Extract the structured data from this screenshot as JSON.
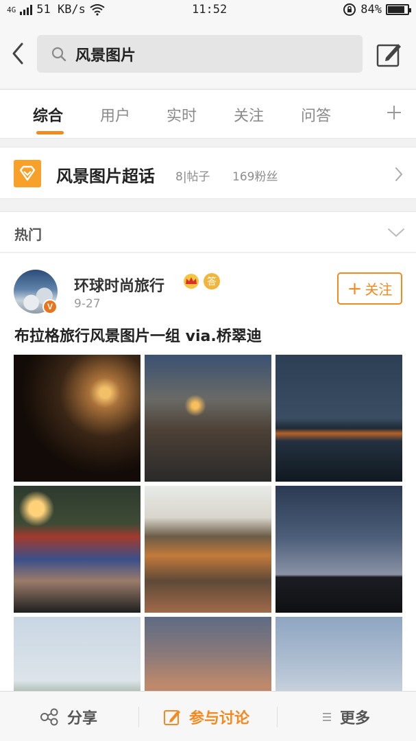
{
  "status_bar": {
    "network": "4G",
    "speed": "51 KB/s",
    "time": "11:52",
    "battery": "84%",
    "battery_level": 0.84
  },
  "header": {
    "search_query": "风景图片",
    "icons": {
      "back": "chevron-left-icon",
      "search": "search-icon",
      "edit": "edit-icon"
    }
  },
  "tabs": {
    "items": [
      {
        "label": "综合",
        "active": true
      },
      {
        "label": "用户",
        "active": false
      },
      {
        "label": "实时",
        "active": false
      },
      {
        "label": "关注",
        "active": false
      },
      {
        "label": "问答",
        "active": false
      }
    ],
    "plus_icon": "plus-icon"
  },
  "super_topic": {
    "title": "风景图片超话",
    "posts": "8|帖子",
    "fans": "169粉丝",
    "accent": "#f8a12a"
  },
  "hot": {
    "label": "热门"
  },
  "post": {
    "author": "环球时尚旅行",
    "time": "9-27",
    "verified_badge": "V",
    "medal": "答",
    "follow_label": "关注",
    "text": "布拉格旅行风景图片一组 via.桥翠迪",
    "photo_count": 9
  },
  "bottom_bar": {
    "share": "分享",
    "discuss": "参与讨论",
    "more": "更多",
    "accent": "#f28a20"
  }
}
